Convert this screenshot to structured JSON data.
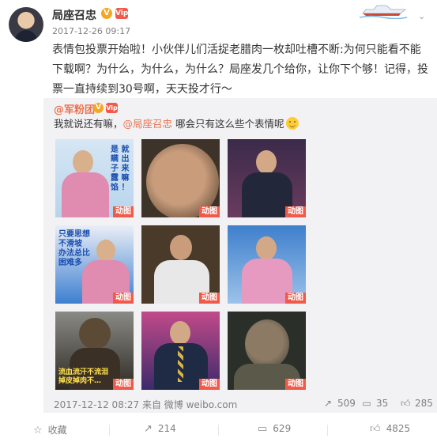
{
  "post": {
    "username": "局座召忠",
    "timestamp": "2017-12-26 09:17",
    "text": "表情包投票开始啦！小伙伴儿们活捉老腊肉一枚却吐槽不断:为何只能看不能下载啊？为什么，为什么，为什么？局座发几个给你，让你下个够！记得，投票一直持续到30号啊，天天投才行～",
    "badge_v": "V",
    "badge_vip": "Vip"
  },
  "repost": {
    "username": "@军粉团",
    "text_before": "我就说还有嘛，",
    "mention": "@局座召忠",
    "text_after": " 哪会只有这么些个表情呢",
    "gif_tag": "动图",
    "captions": {
      "g1": "是 就\n瞒 出\n子 来\n露 嘛\n馅 ！",
      "g4": "只要思想\n不滑坡\n办法总比\n困难多",
      "g7": "流血流汗不流泪\n掉皮掉肉不…"
    },
    "meta": "2017-12-12 08:27 来自 微博 weibo.com",
    "stats": {
      "reposts": "509",
      "comments": "35",
      "likes": "285"
    }
  },
  "actions": {
    "favorite": "收藏",
    "repost": "214",
    "comment": "629",
    "like": "4825"
  },
  "colors": {
    "accent": "#eb7350",
    "badge_red": "#f05a4a",
    "badge_gold": "#f5a623",
    "repost_bg": "#f2f2f5"
  }
}
